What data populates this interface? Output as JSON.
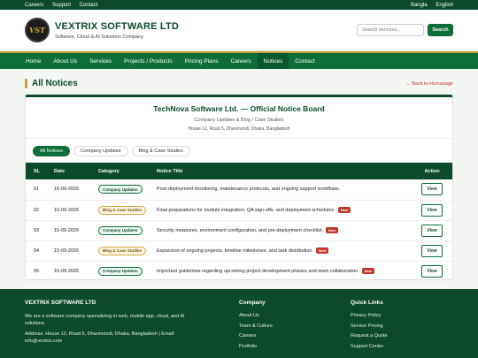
{
  "topbar": {
    "left": [
      "Careers",
      "Support",
      "Contact"
    ],
    "right": [
      "Bangla",
      "English"
    ]
  },
  "header": {
    "logo_text": "VST",
    "company_name": "VEXTRIX SOFTWARE LTD",
    "tagline": "Software, Cloud & AI Solutions Company",
    "search_placeholder": "Search services...",
    "search_label": "Search"
  },
  "nav": [
    "Home",
    "About Us",
    "Services",
    "Projects / Products",
    "Pricing Plans",
    "Careers",
    "Notices",
    "Contact"
  ],
  "nav_active": "Notices",
  "page": {
    "title": "All Notices",
    "back_link": "← Back to Homepage"
  },
  "board": {
    "title": "TechNova Software Ltd. — Official Notice Board",
    "subtitle": "Company Updates & Blog / Case Studies",
    "address": "House 12, Road 5, Dhanmondi, Dhaka, Bangladesh"
  },
  "filters": [
    "All Notices",
    "Company Updates",
    "Blog & Case Studies"
  ],
  "table": {
    "headers": {
      "sl": "SL",
      "date": "Date",
      "category": "Category",
      "title": "Notice Title",
      "action": "Action"
    },
    "new_label": "New",
    "view_label": "View",
    "rows": [
      {
        "sl": "01",
        "date": "15-09-2026",
        "category": "Company Updates",
        "cat_type": "cu",
        "title": "Post-deployment monitoring, maintenance protocols, and ongoing support workflows.",
        "new": false
      },
      {
        "sl": "02",
        "date": "15-09-2026",
        "category": "Blog & Case Studies",
        "cat_type": "bl",
        "title": "Final preparations for module integration, QA sign-offs, and deployment schedules.",
        "new": true
      },
      {
        "sl": "03",
        "date": "15-09-2026",
        "category": "Company Updates",
        "cat_type": "cu",
        "title": "Security measures, environment configuration, and pre-deployment checklist.",
        "new": true
      },
      {
        "sl": "04",
        "date": "15-09-2026",
        "category": "Blog & Case Studies",
        "cat_type": "bl",
        "title": "Expansion of ongoing projects, timeline milestones, and task distribution.",
        "new": true
      },
      {
        "sl": "05",
        "date": "15-09-2026",
        "category": "Company Updates",
        "cat_type": "cu",
        "title": "Important guidelines regarding upcoming project development phases and team collaboration.",
        "new": true
      }
    ]
  },
  "footer": {
    "about_title": "VEXTRIX SOFTWARE LTD",
    "about_text": "We are a software company specializing in web, mobile app, cloud, and AI solutions.",
    "address": "Address: House 12, Road 5, Dhanmondi, Dhaka, Bangladesh | Email: info@vextrix.com",
    "company_title": "Company",
    "company_links": [
      "About Us",
      "Team & Culture",
      "Careers",
      "Portfolio"
    ],
    "quick_title": "Quick Links",
    "quick_links": [
      "Privacy Policy",
      "Service Pricing",
      "Request a Quote",
      "Support Center"
    ]
  },
  "colors": {
    "primary": "#0d6e3a",
    "dark": "#0b4a2a",
    "accent": "#c9a23a",
    "new_badge": "#c0392b"
  }
}
